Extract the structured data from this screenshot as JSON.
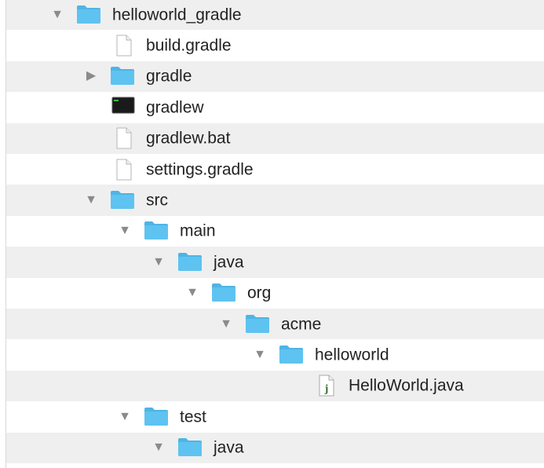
{
  "tree": {
    "items": [
      {
        "label": "helloworld_gradle",
        "kind": "folder",
        "toggle": "expanded",
        "icon": "folder-icon"
      },
      {
        "label": "build.gradle",
        "kind": "file",
        "icon": "document-icon"
      },
      {
        "label": "gradle",
        "kind": "folder",
        "toggle": "collapsed",
        "icon": "folder-icon"
      },
      {
        "label": "gradlew",
        "kind": "exec",
        "icon": "terminal-executable-icon"
      },
      {
        "label": "gradlew.bat",
        "kind": "file",
        "icon": "document-icon"
      },
      {
        "label": "settings.gradle",
        "kind": "file",
        "icon": "document-icon"
      },
      {
        "label": "src",
        "kind": "folder",
        "toggle": "expanded",
        "icon": "folder-icon"
      },
      {
        "label": "main",
        "kind": "folder",
        "toggle": "expanded",
        "icon": "folder-icon"
      },
      {
        "label": "java",
        "kind": "folder",
        "toggle": "expanded",
        "icon": "folder-icon"
      },
      {
        "label": "org",
        "kind": "folder",
        "toggle": "expanded",
        "icon": "folder-icon"
      },
      {
        "label": "acme",
        "kind": "folder",
        "toggle": "expanded",
        "icon": "folder-icon"
      },
      {
        "label": "helloworld",
        "kind": "folder",
        "toggle": "expanded",
        "icon": "folder-icon"
      },
      {
        "label": "HelloWorld.java",
        "kind": "java",
        "icon": "java-file-icon"
      },
      {
        "label": "test",
        "kind": "folder",
        "toggle": "expanded",
        "icon": "folder-icon"
      },
      {
        "label": "java",
        "kind": "folder",
        "toggle": "expanded",
        "icon": "folder-icon"
      }
    ]
  },
  "colors": {
    "folder": "#5ec3f0",
    "folder_tab": "#4fb4e4",
    "row_alt": "#efefef",
    "text": "#222222",
    "disclosure": "#8a8a8a"
  }
}
